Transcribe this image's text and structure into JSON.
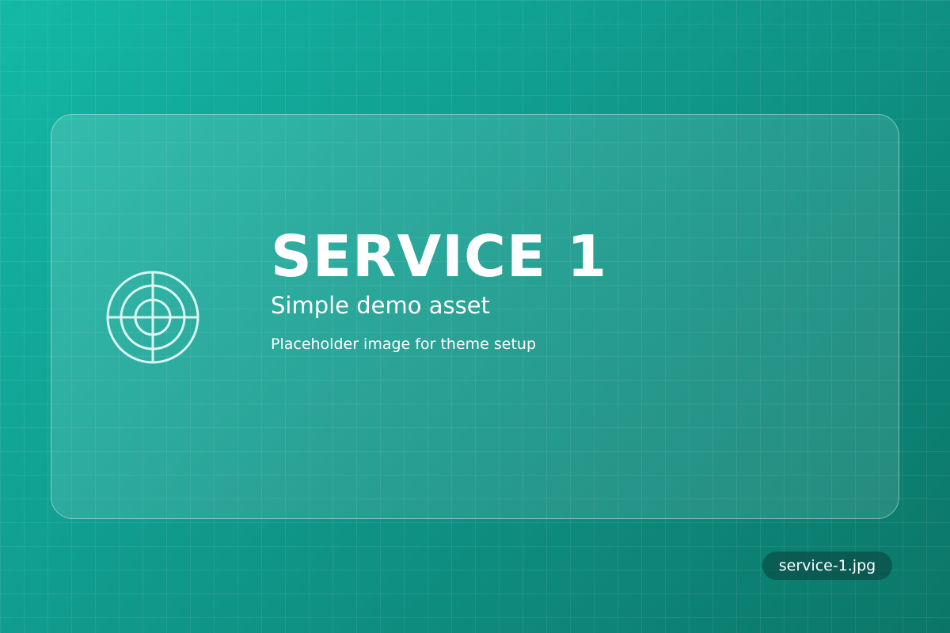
{
  "card": {
    "title": "SERVICE 1",
    "subtitle": "Simple demo asset",
    "description": "Placeholder image for theme setup",
    "icon": "target-icon"
  },
  "badge": {
    "filename": "service-1.jpg"
  },
  "colors": {
    "background_start": "#14b8a6",
    "background_end": "#0b7668",
    "icon_stroke": "#d9f7f1",
    "text": "#ffffff"
  }
}
